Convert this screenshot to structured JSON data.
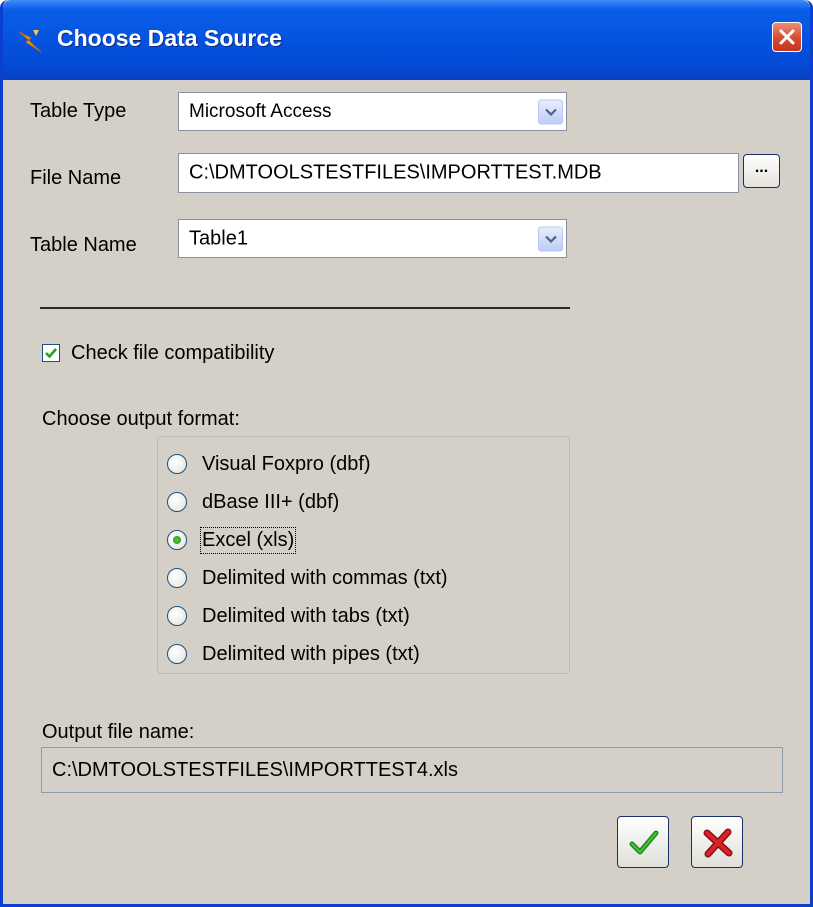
{
  "window": {
    "title": "Choose Data Source"
  },
  "form": {
    "table_type_label": "Table Type",
    "table_type_value": "Microsoft Access",
    "file_name_label": "File Name",
    "file_name_value": "C:\\DMTOOLSTESTFILES\\IMPORTTEST.MDB",
    "browse_label": "...",
    "table_name_label": "Table Name",
    "table_name_value": "Table1",
    "check_compat_label": "Check file compatibility",
    "check_compat_checked": true,
    "output_format_label": "Choose output format:",
    "output_formats": [
      {
        "label": "Visual Foxpro (dbf)",
        "selected": false
      },
      {
        "label": "dBase III+ (dbf)",
        "selected": false
      },
      {
        "label": "Excel (xls)",
        "selected": true
      },
      {
        "label": "Delimited with commas (txt)",
        "selected": false
      },
      {
        "label": "Delimited with tabs (txt)",
        "selected": false
      },
      {
        "label": "Delimited with pipes (txt)",
        "selected": false
      }
    ],
    "output_file_label": "Output file name:",
    "output_file_value": "C:\\DMTOOLSTESTFILES\\IMPORTTEST4.xls"
  },
  "icons": {
    "title": "lightning-bolt-icon",
    "close": "close-icon",
    "ok": "checkmark-icon",
    "cancel": "red-x-icon"
  },
  "colors": {
    "titlebar": "#0553e0",
    "window_bg": "#d4d0c8",
    "close_button": "#d6462a",
    "ok_check": "#1b8a17",
    "cancel_x": "#c8161e"
  }
}
